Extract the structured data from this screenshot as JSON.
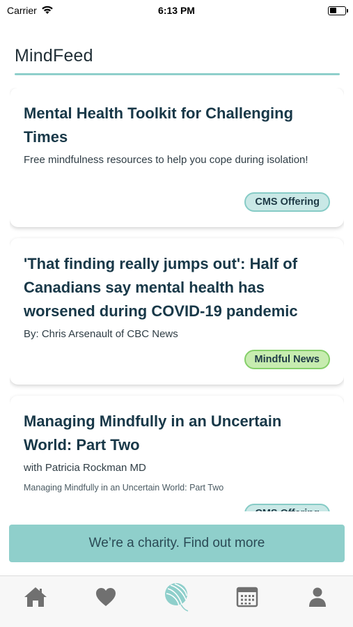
{
  "status_bar": {
    "carrier": "Carrier",
    "time": "6:13 PM",
    "battery_level": 0.45
  },
  "header": {
    "title": "MindFeed"
  },
  "cards": [
    {
      "title": "Mental Health Toolkit for Challenging Times",
      "subtitle": "Free mindfulness resources to help you cope during isolation!",
      "badge": "CMS Offering"
    },
    {
      "title": "'That finding really jumps out': Half of Canadians say mental health has worsened during COVID-19 pandemic",
      "subtitle": "By: Chris Arsenault of CBC News",
      "badge": "Mindful News"
    },
    {
      "title": "Managing Mindfully in an Uncertain World: Part Two",
      "subtitle": "with Patricia Rockman MD",
      "small": "Managing Mindfully in an Uncertain World: Part Two",
      "badge": "CMS Offering"
    }
  ],
  "charity_banner": {
    "label": "We’re a charity. Find out more"
  },
  "tabs": [
    {
      "icon": "home-icon"
    },
    {
      "icon": "heart-icon"
    },
    {
      "icon": "yarn-ball-icon",
      "active": true
    },
    {
      "icon": "calendar-icon"
    },
    {
      "icon": "profile-icon"
    }
  ],
  "colors": {
    "accent": "#8fcfcb",
    "cms_badge_bg": "#c9e8e6",
    "news_badge_bg": "#c7ecb0",
    "title_text": "#183848",
    "tab_icon": "#707070"
  }
}
